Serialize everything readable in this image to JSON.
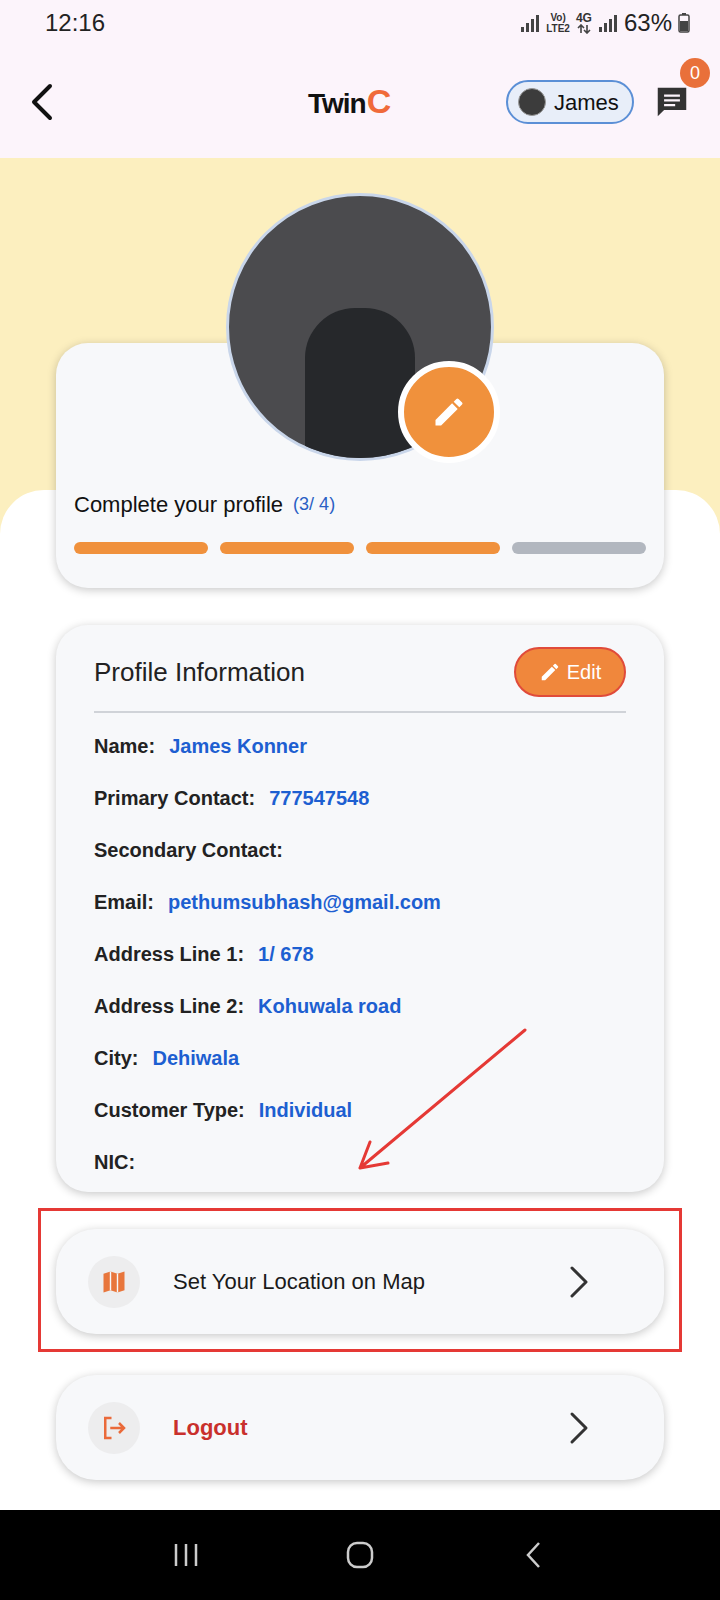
{
  "status_bar": {
    "time": "12:16",
    "volte_top": "Vo)",
    "volte_bottom": "LTE2",
    "network": "4G",
    "battery": "63%"
  },
  "header": {
    "logo_text": "Twin",
    "logo_mark": "C",
    "user": "James",
    "messages_badge": "0"
  },
  "profile": {
    "completion_label": "Complete your profile",
    "completion_count": "(3/ 4)",
    "steps": [
      {
        "done": true
      },
      {
        "done": true
      },
      {
        "done": true
      },
      {
        "done": false
      }
    ]
  },
  "info": {
    "title": "Profile Information",
    "edit_button": "Edit",
    "fields": [
      {
        "label": "Name:",
        "value": "James Konner"
      },
      {
        "label": "Primary Contact:",
        "value": "777547548"
      },
      {
        "label": "Secondary Contact:",
        "value": ""
      },
      {
        "label": "Email:",
        "value": "pethumsubhash@gmail.com"
      },
      {
        "label": "Address Line 1:",
        "value": "1/ 678"
      },
      {
        "label": "Address Line 2:",
        "value": "Kohuwala road"
      },
      {
        "label": "City:",
        "value": "Dehiwala"
      },
      {
        "label": "Customer Type:",
        "value": "Individual"
      },
      {
        "label": "NIC:",
        "value": ""
      }
    ]
  },
  "actions": [
    {
      "label": "Set Your Location on Map",
      "kind": "location",
      "highlighted": true
    },
    {
      "label": "Logout",
      "kind": "logout",
      "highlighted": false
    }
  ]
}
